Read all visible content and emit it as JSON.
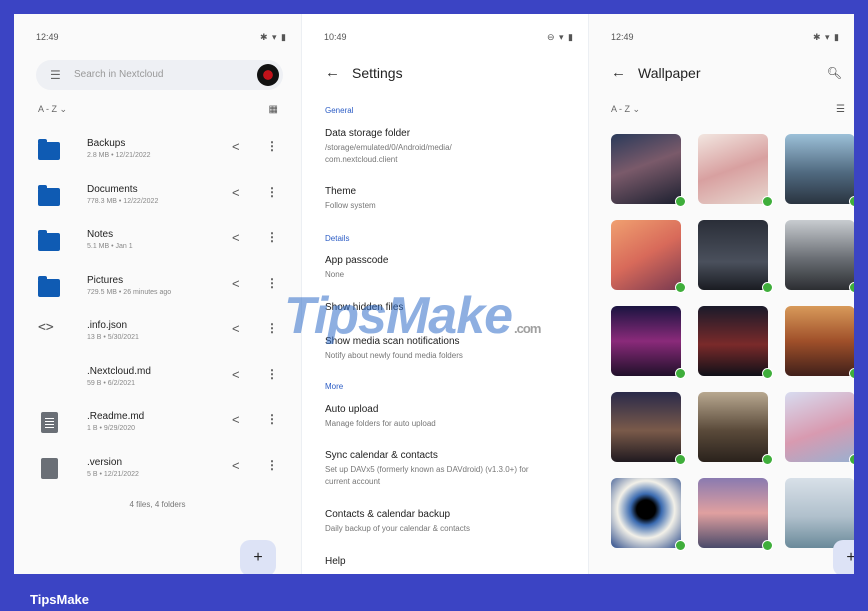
{
  "panel1": {
    "status_time": "12:49",
    "status_right": "✱ ▾ ▮",
    "search_placeholder": "Search in Nextcloud",
    "sort_label": "A - Z",
    "files": [
      {
        "name": "Backups",
        "meta": "2.8 MB • 12/21/2022",
        "icon": "folder-icon"
      },
      {
        "name": "Documents",
        "meta": "778.3 MB • 12/22/2022",
        "icon": "folder-icon"
      },
      {
        "name": "Notes",
        "meta": "5.1 MB • Jan 1",
        "icon": "folder-icon"
      },
      {
        "name": "Pictures",
        "meta": "729.5 MB • 26 minutes ago",
        "icon": "folder-icon"
      },
      {
        "name": ".info.json",
        "meta": "13 B • 5/30/2021",
        "icon": "code-icon"
      },
      {
        "name": ".Nextcloud.md",
        "meta": "59 B • 6/2/2021",
        "icon": "none"
      },
      {
        "name": ".Readme.md",
        "meta": "1 B • 9/29/2020",
        "icon": "document-icon"
      },
      {
        "name": ".version",
        "meta": "5 B • 12/21/2022",
        "icon": "file-icon"
      }
    ],
    "summary": "4 files, 4 folders",
    "fab": "+"
  },
  "panel2": {
    "status_time": "10:49",
    "status_right": "⊖ ▾ ▮",
    "title": "Settings",
    "sections": [
      {
        "label": "General"
      },
      {
        "label": "Details"
      },
      {
        "label": "More"
      }
    ],
    "settings": [
      {
        "title": "Data storage folder",
        "subtitle": "/storage/emulated/0/Android/media/\ncom.nextcloud.client"
      },
      {
        "title": "Theme",
        "subtitle": "Follow system"
      },
      {
        "title": "App passcode",
        "subtitle": "None"
      },
      {
        "title": "Show hidden files",
        "subtitle": ""
      },
      {
        "title": "Show media scan notifications",
        "subtitle": "Notify about newly found media folders"
      },
      {
        "title": "Auto upload",
        "subtitle": "Manage folders for auto upload"
      },
      {
        "title": "Sync calendar & contacts",
        "subtitle": "Set up DAVx5 (formerly known as DAVdroid) (v1.3.0+) for\ncurrent account"
      },
      {
        "title": "Contacts & calendar backup",
        "subtitle": "Daily backup of your calendar & contacts"
      },
      {
        "title": "Help",
        "subtitle": ""
      }
    ]
  },
  "panel3": {
    "status_time": "12:49",
    "status_right": "✱ ▾ ▮",
    "title": "Wallpaper",
    "sort_label": "A - Z",
    "fab": "+"
  },
  "watermark": {
    "main": "TipsMake",
    "domain": ".com"
  },
  "brand": "TipsMake",
  "colors": {
    "frame_border": "#3b44c4",
    "accent": "#2b5cc5",
    "folder": "#0f5bb3",
    "check": "#3fae3b"
  }
}
